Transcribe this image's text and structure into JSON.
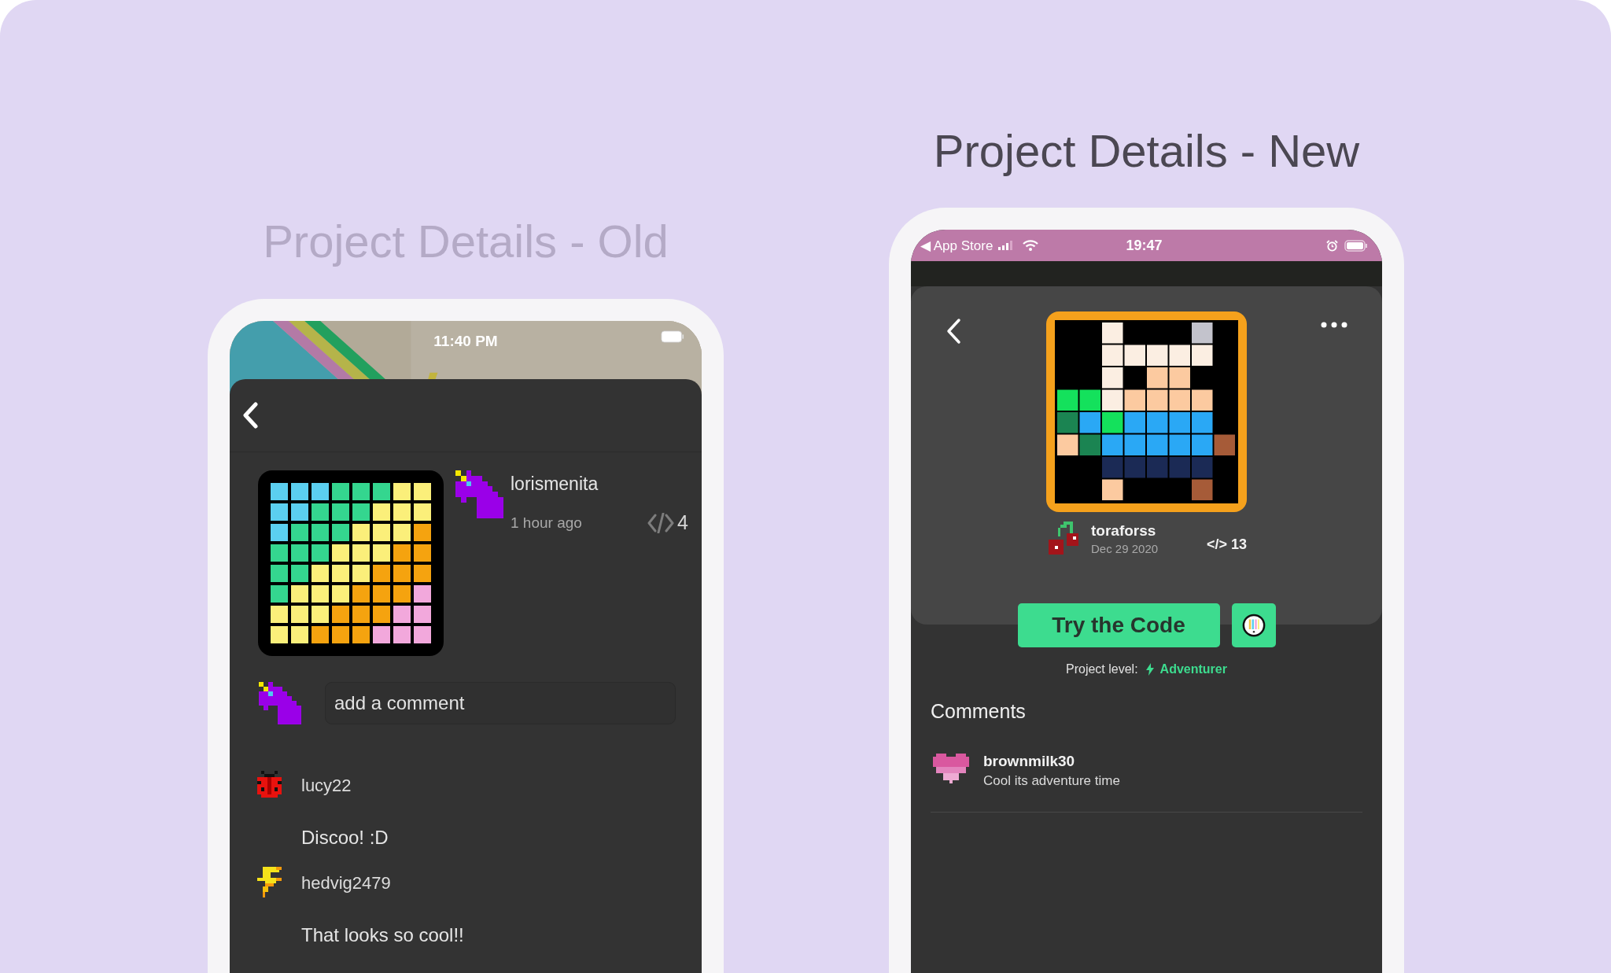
{
  "old": {
    "title": "Project Details - Old",
    "status_bar": {
      "time": "11:40 PM"
    },
    "project": {
      "author": "lorismenita",
      "posted": "1 hour ago",
      "code_count": "4"
    },
    "comment_field": {
      "placeholder": "add a comment"
    },
    "comments": [
      {
        "user": "lucy22",
        "text": "Discoo! :D"
      },
      {
        "user": "hedvig2479",
        "text": "That looks so cool!!"
      }
    ]
  },
  "new": {
    "title": "Project Details - New",
    "status_bar": {
      "back_label": "◀ App Store",
      "time": "19:47"
    },
    "project": {
      "author": "toraforss",
      "date": "Dec 29 2020",
      "code_count": "</> 13"
    },
    "try_button": "Try the Code",
    "level": {
      "label": "Project level:",
      "value": "Adventurer"
    },
    "comments_heading": "Comments",
    "comments": [
      {
        "user": "brownmilk30",
        "text": "Cool its adventure time"
      }
    ]
  }
}
